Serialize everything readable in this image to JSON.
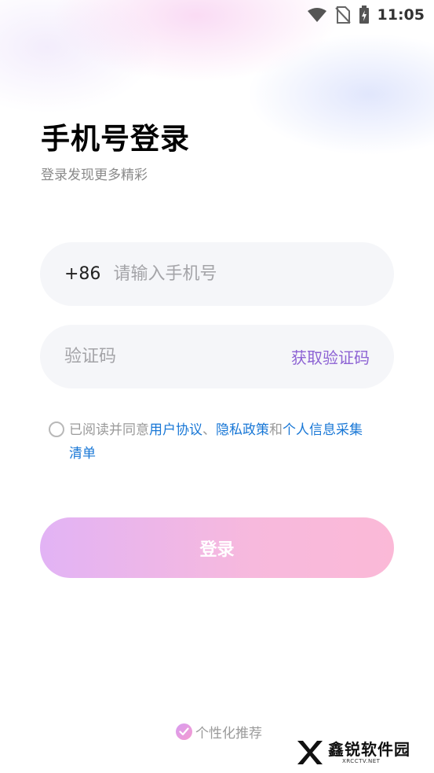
{
  "status_bar": {
    "time": "11:05",
    "icons": [
      "wifi-icon",
      "no-sim-icon",
      "battery-charging-icon"
    ]
  },
  "header": {
    "title": "手机号登录",
    "subtitle": "登录发现更多精彩"
  },
  "phone_field": {
    "country_code": "+86",
    "placeholder": "请输入手机号",
    "value": ""
  },
  "code_field": {
    "placeholder": "验证码",
    "value": "",
    "get_code_label": "获取验证码"
  },
  "agreement": {
    "checked": false,
    "prefix": "已阅读并同意",
    "user_agreement": "用户协议",
    "separator": "、",
    "privacy_policy": "隐私政策",
    "and": "和",
    "personal_info_list_part1": "个人信息采集",
    "personal_info_list_part2": "清单"
  },
  "login_button": {
    "label": "登录"
  },
  "personalized": {
    "checked": true,
    "label": "个性化推荐"
  },
  "watermark": {
    "text": "鑫锐软件园",
    "subtext": "XRCCTV.NET"
  },
  "colors": {
    "accent_purple": "#8d63d4",
    "link_blue": "#1877d6",
    "button_gradient_start": "#e2b3f5",
    "button_gradient_end": "#fbb9d7"
  }
}
